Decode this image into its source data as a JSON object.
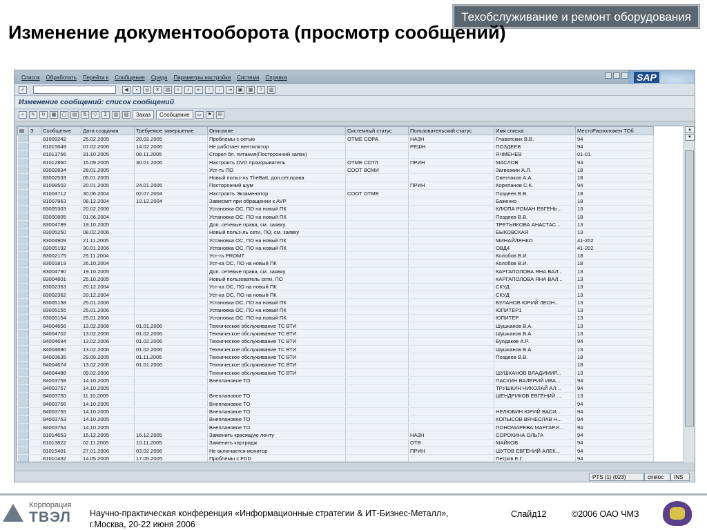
{
  "banner": "Техобслуживание и ремонт оборудования",
  "slide_title": "Изменение документооборота (просмотр сообщений)",
  "sap": {
    "logo": "SAP",
    "menu": [
      "Список",
      "Обработать",
      "Перейти к",
      "Сообщение",
      "Среда",
      "Параметры настройки",
      "Система",
      "Справка"
    ],
    "screen_title": "Изменение сообщений: список сообщений",
    "app_buttons": {
      "order": "Заказ",
      "message": "Сообщение"
    },
    "columns": [
      "З",
      "Сообщение",
      "Дата создания",
      "Требуемое завершение",
      "Описание",
      "Системный статус",
      "Пользовательский статус",
      "Имя списка",
      "МестоРасположен ТОб"
    ],
    "rows": [
      [
        "81009242",
        "25.02.2005",
        "28.02.2005",
        "Проблемы с сетью",
        "ОТМЕ СОРА",
        "НАЗН",
        "Главатских В.В.",
        "94"
      ],
      [
        "81015649",
        "07.02.2006",
        "14.02.2006",
        "Не работает вентилятор",
        "",
        "РЕШН",
        "ПОЗДЕЕВ",
        "94"
      ],
      [
        "81013756",
        "31.10.2005",
        "08.11.2005",
        "Сгорел бл. питания(Посторонний запах)",
        "",
        "",
        "ЯЧМЕНЕВ",
        "01-01"
      ],
      [
        "81012860",
        "15.09.2005",
        "30.01.2006",
        "Настроить DVD проигрыватель",
        "ОТМЕ СОТЛ",
        "ПРИН",
        "МАСЛОВ",
        "94"
      ],
      [
        "83002834",
        "28.01.2005",
        "",
        "Уст-ть ПО",
        "СООТ ВСМИ",
        "",
        "Загвозкин А.Л.",
        "18"
      ],
      [
        "83002533",
        "05.01.2005",
        "",
        "Новый польз-ль TheBatt, доп.сет.права",
        "",
        "",
        "Светлаков А.А.",
        "18"
      ],
      [
        "81008502",
        "20.01.2005",
        "24.01.2005",
        "Посторонний шум",
        "",
        "ПРИН",
        "Корепанов С.К.",
        "94"
      ],
      [
        "81004712",
        "30.06.2004",
        "02.07.2004",
        "Настроить Экзаменатор",
        "СООТ ОТМЕ",
        "",
        "Поздеев В.В.",
        "18"
      ],
      [
        "81007863",
        "08.12.2004",
        "10.12.2004",
        "Зависает при обращении к AVP",
        "",
        "",
        "Баженко",
        "18"
      ],
      [
        "83005303",
        "20.02.2006",
        "",
        "Установка ОС, ПО на новый ПК",
        "",
        "",
        "КЛЮПА РОМАН ЕВГЕНЬ...",
        "13"
      ],
      [
        "83000805",
        "01.06.2004",
        "",
        "Установка ОС, ПО на новый ПК",
        "",
        "",
        "Поздеев В.В.",
        "18"
      ],
      [
        "83004789",
        "19.10.2005",
        "",
        "Доп. сетевые права, см. заявку",
        "",
        "",
        "ТРЕТЬЯКОВА АНАСТАС...",
        "13"
      ],
      [
        "83005250",
        "08.02.2006",
        "",
        "Новый польз-ль сети, ПО, см. заявку",
        "",
        "",
        "БЫКОВСКАЯ",
        "13"
      ],
      [
        "83004909",
        "21.11.2005",
        "",
        "Установка ОС, ПО на новый ПК",
        "",
        "",
        "МИНАЙЛЕНКО",
        "41-202"
      ],
      [
        "83005192",
        "30.01.2006",
        "",
        "Установка ОС, ПО на новый ПК",
        "",
        "",
        "ОВД4",
        "41-202"
      ],
      [
        "83002175",
        "25.11.2004",
        "",
        "Уст-ть PROMT",
        "",
        "",
        "Колобов В.И.",
        "18"
      ],
      [
        "83001819",
        "26.10.2004",
        "",
        "Уст-ка ОС, ПО на новый ПК",
        "",
        "",
        "Колобов В.И.",
        "18"
      ],
      [
        "83004790",
        "19.10.2005",
        "",
        "Доп. сетевые права, см. заявку",
        "",
        "",
        "КАРГАПОЛОВА ЯНА ВАЛ...",
        "13"
      ],
      [
        "83004801",
        "25.10.2005",
        "",
        "Новый пользователь сети, ПО",
        "",
        "",
        "КАРГАПОЛОВА ЯНА ВАЛ...",
        "13"
      ],
      [
        "83002363",
        "20.12.2004",
        "",
        "Уст-ка ОС, ПО на новый ПК",
        "",
        "",
        "СКУД",
        "13"
      ],
      [
        "83002362",
        "20.12.2004",
        "",
        "Уст-ка ОС, ПО на новый ПК",
        "",
        "",
        "СКУД",
        "13"
      ],
      [
        "83005158",
        "25.01.2006",
        "",
        "Установка ОС, ПО на новый ПК",
        "",
        "",
        "БУЛАНОВ ЮРИЙ ЛЕОН...",
        "13"
      ],
      [
        "83005155",
        "25.01.2006",
        "",
        "Установка ОС, ПО на новый ПК",
        "",
        "",
        "ЮПИТЕР1",
        "13"
      ],
      [
        "83005154",
        "25.01.2006",
        "",
        "Установка ОС, ПО на новый ПК",
        "",
        "",
        "ЮПИТЕР",
        "13"
      ],
      [
        "84004656",
        "13.02.2006",
        "01.01.2006",
        "Техническое обслуживание ТС ВТИ",
        "",
        "",
        "Шушканов В.А.",
        "13"
      ],
      [
        "84004702",
        "13.02.2006",
        "01.02.2006",
        "Техническое обслуживание ТС ВТИ",
        "",
        "",
        "Шушканов В.А.",
        "13"
      ],
      [
        "84004694",
        "13.02.2006",
        "01.02.2006",
        "Техническое обслуживание ТС ВТИ",
        "",
        "",
        "Булдаков А.Р.",
        "94"
      ],
      [
        "84004690",
        "13.02.2006",
        "01.02.2006",
        "Техническое обслуживание ТС ВТИ",
        "",
        "",
        "Шушканов В.А.",
        "13"
      ],
      [
        "84003635",
        "29.09.2005",
        "01.11.2005",
        "Техническое обслуживание ТС ВТИ",
        "",
        "",
        "Поздеев В.В.",
        "18"
      ],
      [
        "84004674",
        "13.02.2006",
        "01.01.2006",
        "Техническое обслуживание ТС ВТИ",
        "",
        "",
        "",
        "18"
      ],
      [
        "84004488",
        "09.02.2006",
        "",
        "Техническое обслуживание ТС ВТИ",
        "",
        "",
        "ШУШКАНОВ ВЛАДИМИР...",
        "13"
      ],
      [
        "84003758",
        "14.10.2005",
        "",
        "Внеплановое ТО",
        "",
        "",
        "ПАСХИН ВАЛЕРИЙ ИВА...",
        "94"
      ],
      [
        "84003757",
        "14.10.2005",
        "",
        "",
        "",
        "",
        "ТРУШКИН НИКОЛАЙ АЛ...",
        "94"
      ],
      [
        "84003750",
        "11.10.2005",
        "",
        "Внеплановое ТО",
        "",
        "",
        "ШЕНДРИКОВ ЕВГЕНИЙ ...",
        "13"
      ],
      [
        "84003756",
        "14.10.2005",
        "",
        "Внеплановое ТО",
        "",
        "",
        "",
        "94"
      ],
      [
        "84003755",
        "14.10.2005",
        "",
        "Внеплановое ТО",
        "",
        "",
        "НЕЛЮБИН ЮРИЙ ВАСИ...",
        "94"
      ],
      [
        "84003753",
        "14.10.2005",
        "",
        "Внеплановое ТО",
        "",
        "",
        "КОПЫСОВ ВЯЧЕСЛАВ Н...",
        "94"
      ],
      [
        "84003754",
        "14.10.2005",
        "",
        "Внеплановое ТО",
        "",
        "",
        "ПОНОМАРЕВА МАРГАРИ...",
        "94"
      ],
      [
        "81014653",
        "15.12.2005",
        "16.12.2005",
        "Заменить красящую ленту",
        "",
        "НАЗН",
        "СОРОКИНА ОЛЬГА",
        "94"
      ],
      [
        "81013822",
        "02.11.2005",
        "10.11.2005",
        "Заменить картридж",
        "",
        "ОТВ",
        "МАЙКОВ",
        "94"
      ],
      [
        "81015401",
        "27.01.2006",
        "03.02.2006",
        "Не включается монитор",
        "",
        "ПРИН",
        "ШУТОВ ЕВГЕНИЙ АЛЕК...",
        "94"
      ],
      [
        "81010432",
        "14.05.2005",
        "17.05.2005",
        "Проблемы с FDD",
        "",
        "",
        "Петров Е.Г.",
        "94"
      ]
    ],
    "status": {
      "session": "PTS (1) (023)",
      "host": "cireloc",
      "mode": "INS"
    }
  },
  "footer": {
    "corp": "Корпорация",
    "brand": "ТВЭЛ",
    "conference_line1": "Научно-практическая конференция «Информационные стратегии & ИТ-Бизнес-Металл»,",
    "conference_line2": "г.Москва, 20-22 июня 2006",
    "slide": "Слайд12",
    "copyright": "©2006 ОАО ЧМЗ"
  }
}
